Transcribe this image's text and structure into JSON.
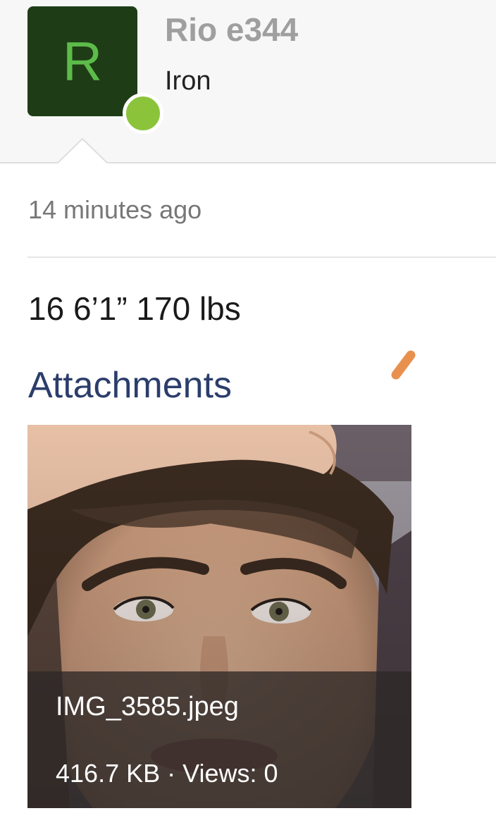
{
  "post": {
    "author": {
      "initial": "R",
      "username": "Rio e344",
      "rank": "Iron",
      "online": true
    },
    "timestamp": "14 minutes ago",
    "body": "16 6’1” 170 lbs"
  },
  "attachments": {
    "heading": "Attachments",
    "items": [
      {
        "file_name": "IMG_3585.jpeg",
        "size": "416.7 KB",
        "separator": " · ",
        "views_label": "Views: 0"
      }
    ]
  },
  "icons": {
    "edit": "pencil-icon",
    "status": "online-status-dot"
  },
  "colors": {
    "avatar_bg": "#1e3d16",
    "avatar_letter": "#5dbb4a",
    "status_online": "#8bc43a",
    "heading_blue": "#2b3d6b",
    "pencil_orange": "#e8914f",
    "username_gray": "#9f9f9f"
  }
}
